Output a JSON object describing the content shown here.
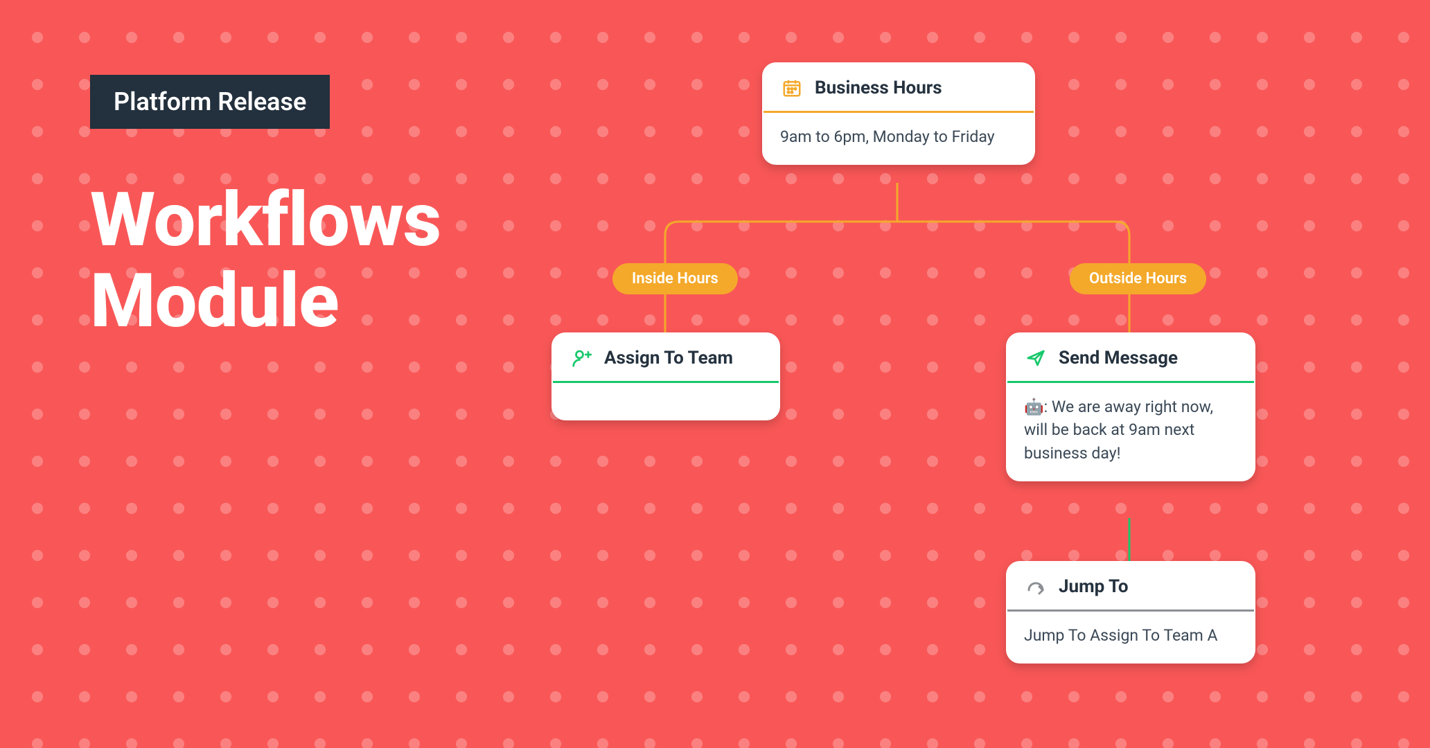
{
  "badge": "Platform Release",
  "headline_line1": "Workflows",
  "headline_line2": "Module",
  "nodes": {
    "root": {
      "title": "Business Hours",
      "body": "9am to 6pm, Monday to Friday",
      "accent": "#f4a92a"
    },
    "left": {
      "title": "Assign To Team",
      "accent": "#18c86b"
    },
    "right": {
      "title": "Send Message",
      "body": "🤖: We are away right now, will be back at 9am next business day!",
      "accent": "#18c86b"
    },
    "jump": {
      "title": "Jump To",
      "body": "Jump To Assign To Team A",
      "accent": "#8b8f94"
    }
  },
  "branches": {
    "left": "Inside Hours",
    "right": "Outside Hours"
  },
  "colors": {
    "orange": "#f4a92a",
    "green": "#18c86b",
    "grey": "#8b8f94"
  }
}
